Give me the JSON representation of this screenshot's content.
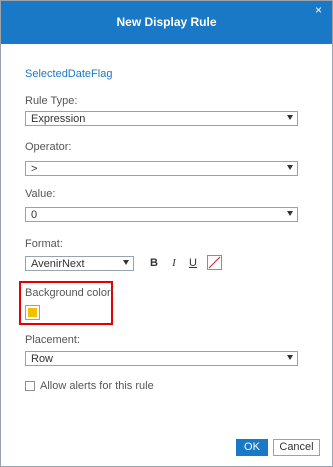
{
  "dialog": {
    "title": "New Display Rule",
    "close_symbol": "×"
  },
  "measure": "SelectedDateFlag",
  "rule_type": {
    "label": "Rule Type:",
    "value": "Expression"
  },
  "operator": {
    "label": "Operator:",
    "value": ">"
  },
  "value": {
    "label": "Value:",
    "value": "0"
  },
  "format": {
    "label": "Format:",
    "font": "AvenirNext",
    "bold_label": "B",
    "italic_label": "I",
    "underline_label": "U",
    "text_color_icon": "no-color-icon"
  },
  "background_color": {
    "label": "Background color:",
    "color": "#f5c000",
    "highlighted": true
  },
  "placement": {
    "label": "Placement:",
    "value": "Row"
  },
  "alerts": {
    "label": "Allow alerts for this rule",
    "checked": false
  },
  "buttons": {
    "ok": "OK",
    "cancel": "Cancel"
  },
  "colors": {
    "accent": "#1a79c7",
    "highlight": "#e50000"
  }
}
